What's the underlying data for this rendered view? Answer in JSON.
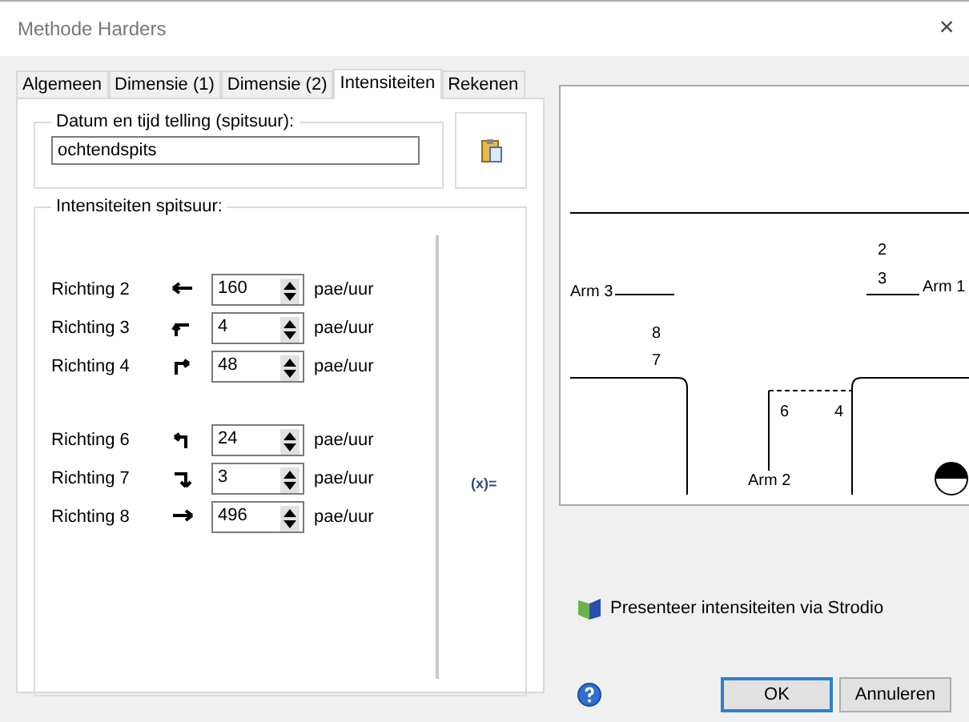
{
  "window": {
    "title": "Methode Harders",
    "close": "×"
  },
  "tabs": [
    {
      "label": "Algemeen",
      "selected": false
    },
    {
      "label": "Dimensie (1)",
      "selected": false
    },
    {
      "label": "Dimensie (2)",
      "selected": false
    },
    {
      "label": "Intensiteiten",
      "selected": true
    },
    {
      "label": "Rekenen",
      "selected": false
    }
  ],
  "date_group": {
    "title": "Datum en tijd telling (spitsuur):",
    "value": "ochtendspits"
  },
  "intensity_group": {
    "title": "Intensiteiten spitsuur:",
    "formula": "(x)=",
    "groups": [
      [
        {
          "label": "Richting 2",
          "value": "160",
          "unit": "pae/uur"
        },
        {
          "label": "Richting 3",
          "value": "4",
          "unit": "pae/uur"
        },
        {
          "label": "Richting 4",
          "value": "48",
          "unit": "pae/uur"
        }
      ],
      [
        {
          "label": "Richting 6",
          "value": "24",
          "unit": "pae/uur"
        },
        {
          "label": "Richting 7",
          "value": "3",
          "unit": "pae/uur"
        },
        {
          "label": "Richting 8",
          "value": "496",
          "unit": "pae/uur"
        }
      ]
    ]
  },
  "diagram": {
    "arms": [
      "Arm 3",
      "Arm 1",
      "Arm 2"
    ],
    "directions": [
      "2",
      "3",
      "8",
      "7",
      "6",
      "4"
    ]
  },
  "strodio_link": "Presenteer intensiteiten via Strodio",
  "buttons": [
    {
      "label": "OK",
      "default": true
    },
    {
      "label": "Annuleren",
      "default": false
    }
  ]
}
